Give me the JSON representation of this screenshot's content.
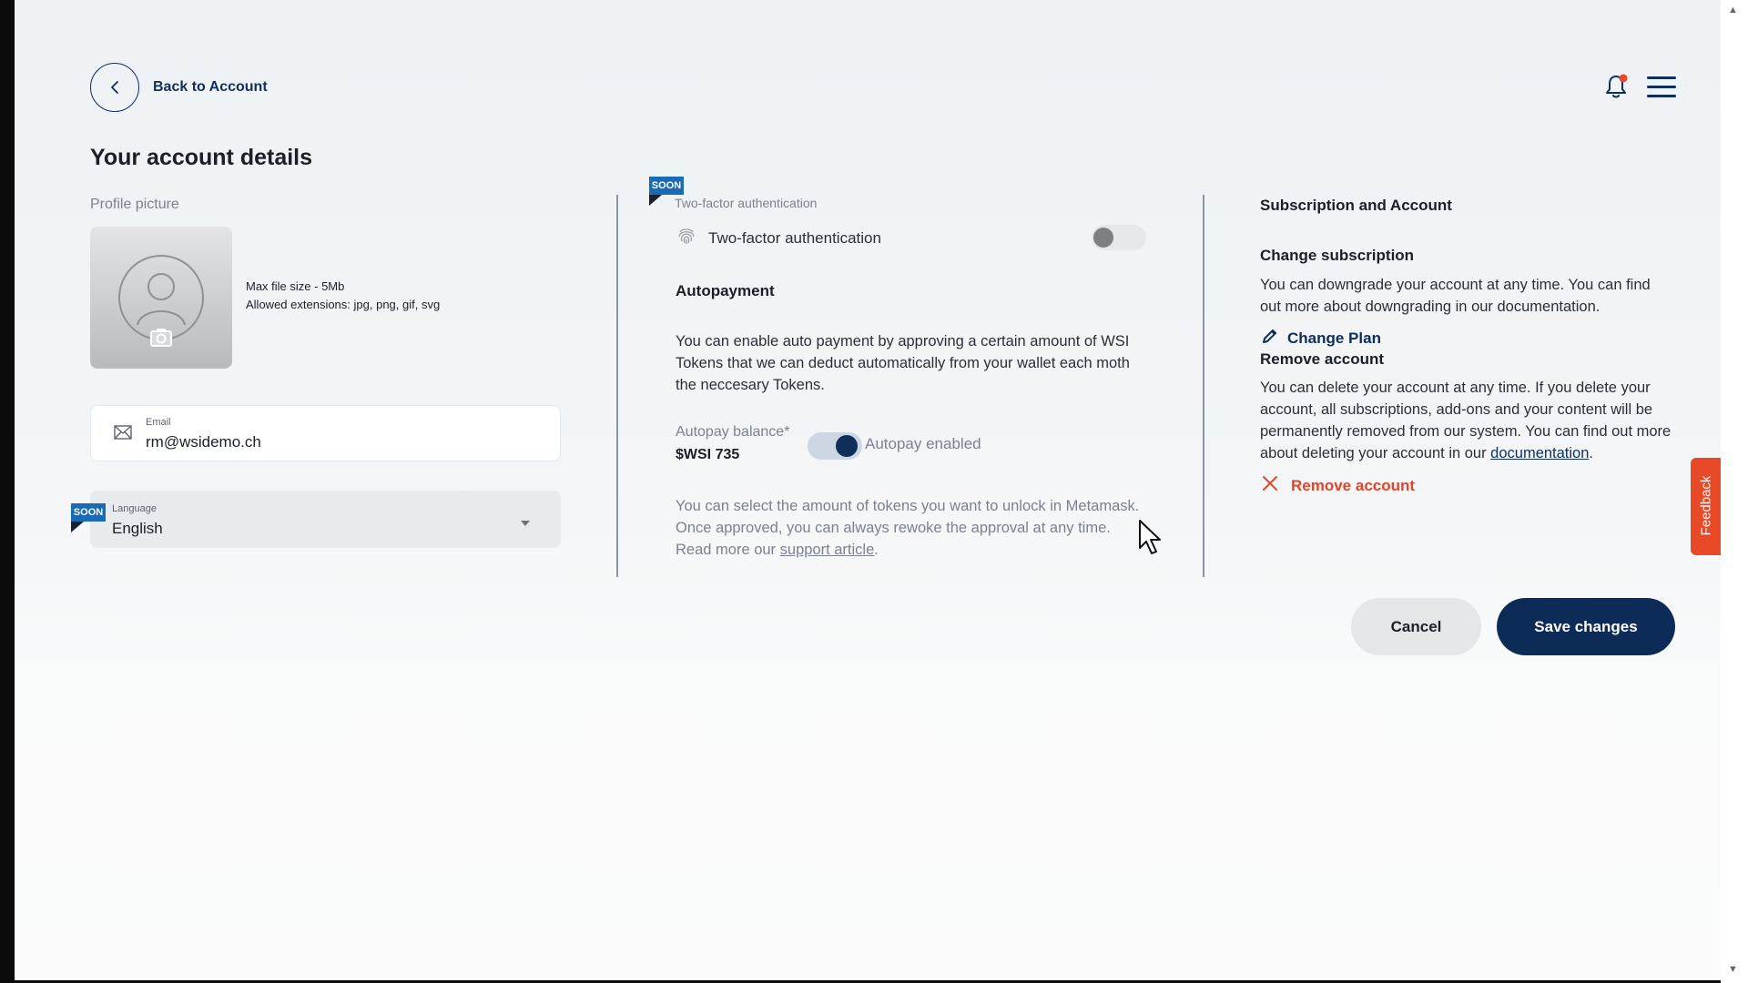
{
  "nav": {
    "back_label": "Back to Account"
  },
  "header": {
    "notification_dot_color": "#e84a28",
    "icons": [
      "bell-icon",
      "hamburger-menu-icon"
    ]
  },
  "page": {
    "title": "Your account details"
  },
  "profile": {
    "label": "Profile picture",
    "max_size": "Max file size - 5Mb",
    "extensions": "Allowed extensions: jpg, png, gif, svg"
  },
  "email": {
    "label": "Email",
    "value": "rm@wsidemo.ch"
  },
  "language": {
    "badge": "SOON",
    "label": "Language",
    "value": "English"
  },
  "two_factor": {
    "badge": "SOON",
    "small_label": "Two-factor authentication",
    "label": "Two-factor authentication",
    "enabled": false
  },
  "autopayment": {
    "heading": "Autopayment",
    "description": "You can enable auto payment by approving a certain amount of WSI Tokens that we can deduct automatically from your wallet each moth the neccesary Tokens.",
    "balance_label": "Autopay balance*",
    "balance_value": "$WSI 735",
    "toggle_label": "Autopay enabled",
    "enabled": true,
    "note_prefix": "You can select the amount of tokens you want to unlock in Metamask. Once approved, you can always rewoke the approval at any time. Read more our ",
    "note_link": "support article",
    "note_suffix": "."
  },
  "subscription": {
    "heading": "Subscription and Account",
    "change_heading": "Change subscription",
    "change_text": "You can downgrade your account at any time. You can find out more about downgrading in our documentation.",
    "change_plan_label": "Change Plan",
    "remove_heading": "Remove account",
    "remove_text_prefix": "You can delete your account at any time. If you delete your account, all subscriptions, add-ons and your content will be permanently removed from our system. You can find out more about deleting your account in our ",
    "remove_link": "documentation",
    "remove_text_suffix": ".",
    "remove_button_label": "Remove account"
  },
  "actions": {
    "cancel_label": "Cancel",
    "save_label": "Save changes"
  },
  "feedback": {
    "label": "Feedback"
  },
  "colors": {
    "brand_navy": "#0c2b57",
    "soon_badge": "#1a6bb5",
    "danger": "#e84a28"
  }
}
